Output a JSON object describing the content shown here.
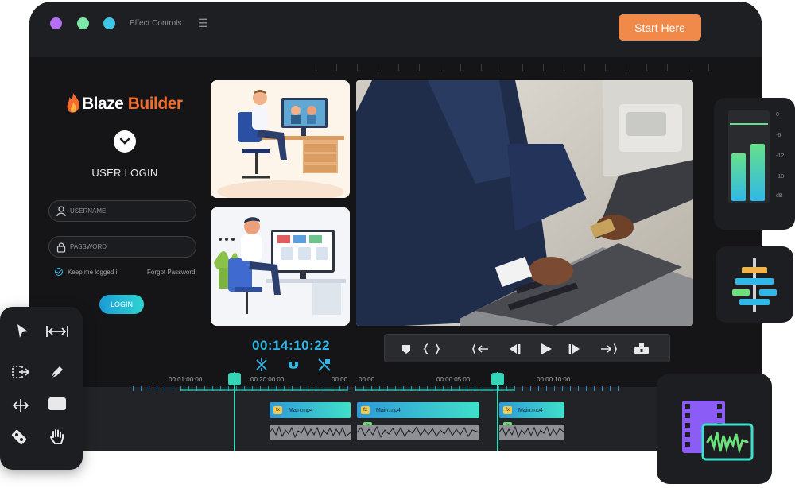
{
  "window": {
    "effect_controls": "Effect Controls",
    "menu_icon": "hamburger-icon",
    "start_here": "Start Here",
    "dot_colors": [
      "#b46ff3",
      "#7be8a8",
      "#3fc6e8"
    ]
  },
  "login": {
    "logo_part1": "Blaze",
    "logo_part2": "Builder",
    "title": "USER LOGIN",
    "username_placeholder": "USERNAME",
    "password_placeholder": "PASSWORD",
    "remember": "Keep me logged i",
    "forgot": "Forgot Password",
    "button": "LOGIN"
  },
  "playback": {
    "timecode": "00:14:10:22",
    "icons": [
      "snip-icon",
      "magnet-icon",
      "split-icon"
    ]
  },
  "transport": {
    "icons": [
      "marker-icon",
      "brackets-icon",
      "go-to-in-icon",
      "step-back-icon",
      "play-icon",
      "step-forward-icon",
      "go-to-out-icon",
      "export-frame-icon"
    ]
  },
  "timeline": {
    "time_labels": [
      "00:01:00:00",
      "00:20:00:00",
      "00:00",
      "00:00",
      "00:00:05:00",
      "00:00:10:00"
    ],
    "clips": [
      {
        "label": "Main.mp4",
        "fx": "fx"
      },
      {
        "label": "Main.mp4",
        "fx": "fx"
      },
      {
        "label": "Main.mp4",
        "fx": "fx"
      }
    ]
  },
  "meter": {
    "db_labels": [
      "0",
      "-6",
      "-12",
      "-18",
      "dB"
    ],
    "left_level": 0.62,
    "right_level": 0.75
  },
  "colors": {
    "accent_orange": "#f08a4b",
    "accent_cyan": "#2fb8e8",
    "playhead": "#35d6b8"
  }
}
